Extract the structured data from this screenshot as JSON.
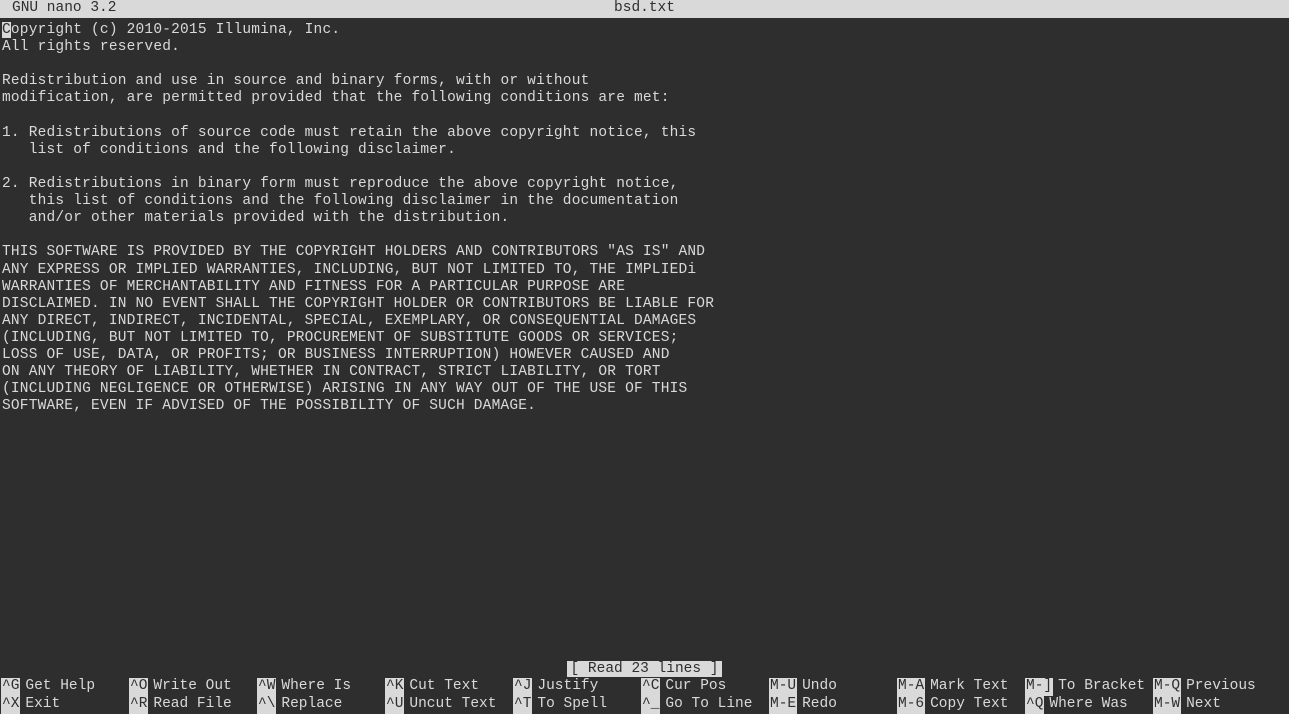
{
  "header": {
    "app": "GNU nano 3.2",
    "filename": "bsd.txt"
  },
  "cursor_char": "C",
  "editor_after_cursor": "opyright (c) 2010-2015 Illumina, Inc.",
  "editor_lines": [
    "All rights reserved.",
    "",
    "Redistribution and use in source and binary forms, with or without",
    "modification, are permitted provided that the following conditions are met:",
    "",
    "1. Redistributions of source code must retain the above copyright notice, this",
    "   list of conditions and the following disclaimer.",
    "",
    "2. Redistributions in binary form must reproduce the above copyright notice,",
    "   this list of conditions and the following disclaimer in the documentation",
    "   and/or other materials provided with the distribution.",
    "",
    "THIS SOFTWARE IS PROVIDED BY THE COPYRIGHT HOLDERS AND CONTRIBUTORS \"AS IS\" AND",
    "ANY EXPRESS OR IMPLIED WARRANTIES, INCLUDING, BUT NOT LIMITED TO, THE IMPLIEDi",
    "WARRANTIES OF MERCHANTABILITY AND FITNESS FOR A PARTICULAR PURPOSE ARE",
    "DISCLAIMED. IN NO EVENT SHALL THE COPYRIGHT HOLDER OR CONTRIBUTORS BE LIABLE FOR",
    "ANY DIRECT, INDIRECT, INCIDENTAL, SPECIAL, EXEMPLARY, OR CONSEQUENTIAL DAMAGES",
    "(INCLUDING, BUT NOT LIMITED TO, PROCUREMENT OF SUBSTITUTE GOODS OR SERVICES;",
    "LOSS OF USE, DATA, OR PROFITS; OR BUSINESS INTERRUPTION) HOWEVER CAUSED AND",
    "ON ANY THEORY OF LIABILITY, WHETHER IN CONTRACT, STRICT LIABILITY, OR TORT",
    "(INCLUDING NEGLIGENCE OR OTHERWISE) ARISING IN ANY WAY OUT OF THE USE OF THIS",
    "SOFTWARE, EVEN IF ADVISED OF THE POSSIBILITY OF SUCH DAMAGE."
  ],
  "status": "[ Read 23 lines ]",
  "footer": {
    "row1": [
      {
        "key": "^G",
        "label": "Get Help"
      },
      {
        "key": "^O",
        "label": "Write Out"
      },
      {
        "key": "^W",
        "label": "Where Is"
      },
      {
        "key": "^K",
        "label": "Cut Text"
      },
      {
        "key": "^J",
        "label": "Justify"
      },
      {
        "key": "^C",
        "label": "Cur Pos"
      },
      {
        "key": "M-U",
        "label": "Undo"
      },
      {
        "key": "M-A",
        "label": "Mark Text"
      },
      {
        "key": "M-]",
        "label": "To Bracket"
      },
      {
        "key": "M-Q",
        "label": "Previous"
      }
    ],
    "row2": [
      {
        "key": "^X",
        "label": "Exit"
      },
      {
        "key": "^R",
        "label": "Read File"
      },
      {
        "key": "^\\",
        "label": "Replace"
      },
      {
        "key": "^U",
        "label": "Uncut Text"
      },
      {
        "key": "^T",
        "label": "To Spell"
      },
      {
        "key": "^_",
        "label": "Go To Line"
      },
      {
        "key": "M-E",
        "label": "Redo"
      },
      {
        "key": "M-6",
        "label": "Copy Text"
      },
      {
        "key": "^Q",
        "label": "Where Was"
      },
      {
        "key": "M-W",
        "label": "Next"
      }
    ]
  }
}
